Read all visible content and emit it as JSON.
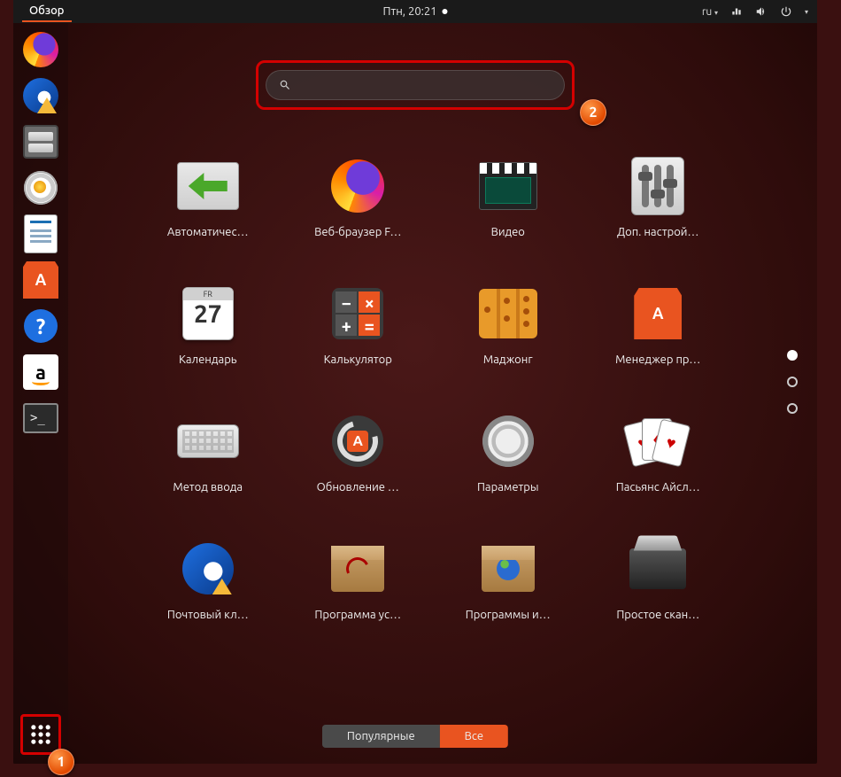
{
  "topbar": {
    "activities": "Обзор",
    "clock": "Птн, 20:21",
    "language": "ru"
  },
  "search": {
    "placeholder": "",
    "value": ""
  },
  "dock": [
    {
      "name": "firefox"
    },
    {
      "name": "thunderbird"
    },
    {
      "name": "files"
    },
    {
      "name": "rhythmbox"
    },
    {
      "name": "writer"
    },
    {
      "name": "software"
    },
    {
      "name": "help"
    },
    {
      "name": "amazon"
    },
    {
      "name": "terminal"
    }
  ],
  "apps": [
    {
      "id": "a1",
      "label": "Автоматичес…"
    },
    {
      "id": "a2",
      "label": "Веб-браузер F…"
    },
    {
      "id": "a3",
      "label": "Видео"
    },
    {
      "id": "a4",
      "label": "Доп. настрой…"
    },
    {
      "id": "a5",
      "label": "Календарь"
    },
    {
      "id": "a6",
      "label": "Калькулятор"
    },
    {
      "id": "a7",
      "label": "Маджонг"
    },
    {
      "id": "a8",
      "label": "Менеджер пр…"
    },
    {
      "id": "a9",
      "label": "Метод ввода"
    },
    {
      "id": "a10",
      "label": "Обновление …"
    },
    {
      "id": "a11",
      "label": "Параметры"
    },
    {
      "id": "a12",
      "label": "Пасьянс Айсл…"
    },
    {
      "id": "a13",
      "label": "Почтовый кл…"
    },
    {
      "id": "a14",
      "label": "Программа ус…"
    },
    {
      "id": "a15",
      "label": "Программы и…"
    },
    {
      "id": "a16",
      "label": "Простое скан…"
    }
  ],
  "calendar_tile": {
    "weekday": "FR",
    "day": "27"
  },
  "toggle": {
    "frequent": "Популярные",
    "all": "Все",
    "active": "all"
  },
  "pages": {
    "count": 3,
    "active": 0
  },
  "badges": {
    "b1": "1",
    "b2": "2"
  }
}
